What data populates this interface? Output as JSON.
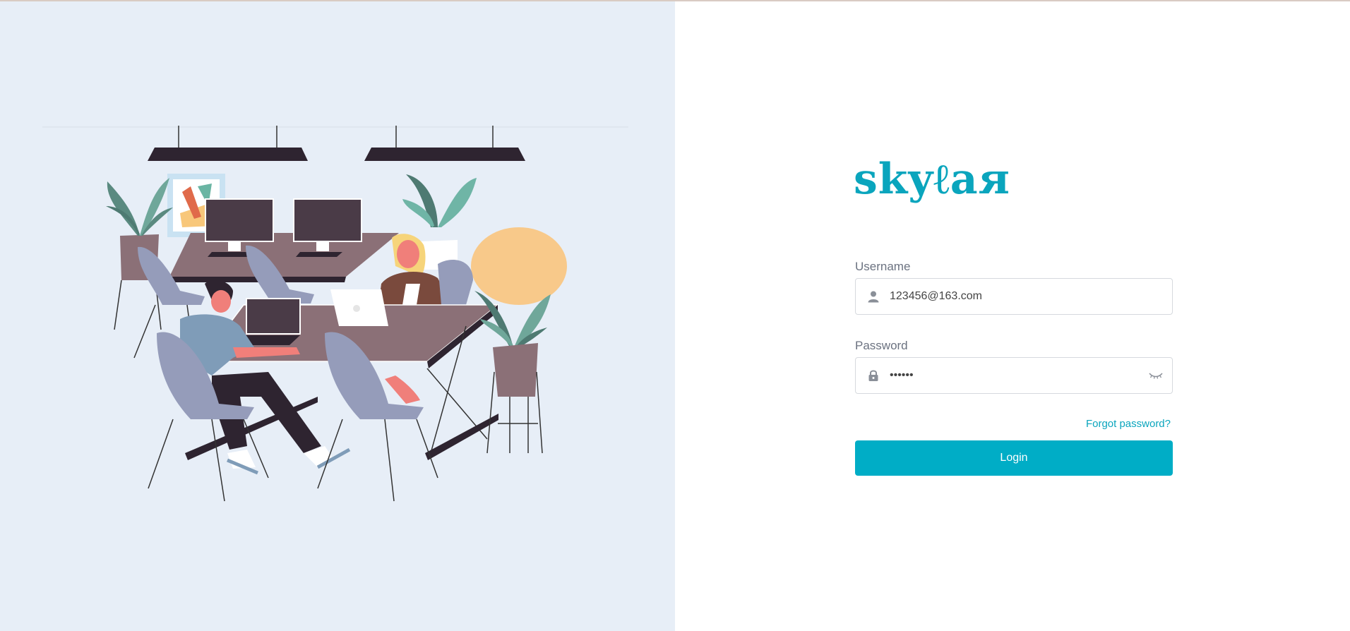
{
  "brand": {
    "logo_text": "skyℓaя",
    "accent_color": "#0aa5bd",
    "button_color": "#00adc6"
  },
  "login_form": {
    "username": {
      "label": "Username",
      "value": "123456@163.com",
      "icon": "user-icon"
    },
    "password": {
      "label": "Password",
      "value": "••••••",
      "icon": "lock-icon",
      "toggle_icon": "eye-closed-icon"
    },
    "forgot_password": "Forgot password?",
    "login_button": "Login"
  },
  "illustration": {
    "subject": "office-workers-illustration",
    "background_color": "#e7eef7"
  }
}
